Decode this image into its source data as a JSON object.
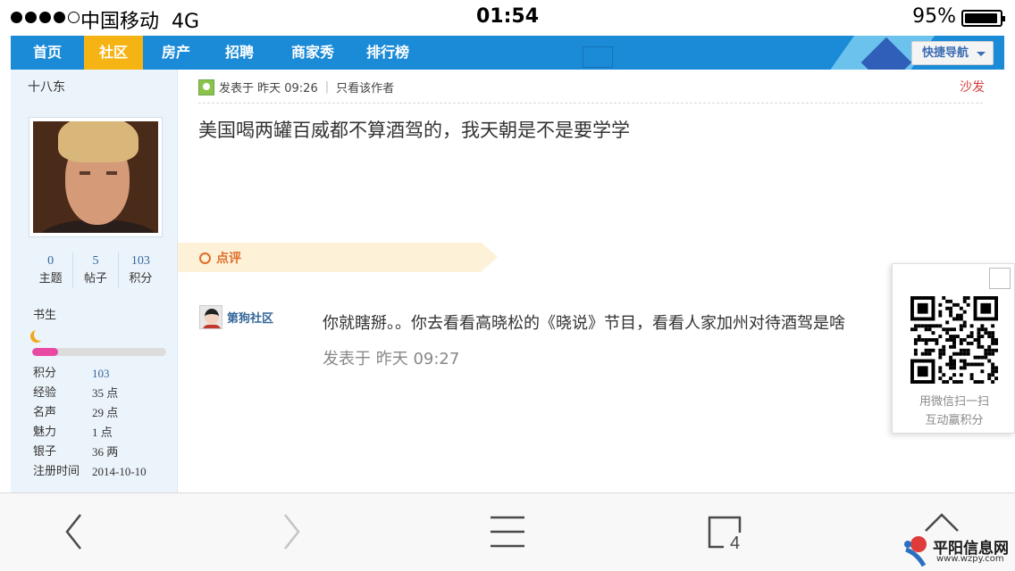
{
  "status_bar": {
    "carrier": "中国移动",
    "network": "4G",
    "time": "01:54",
    "battery_percent": "95%",
    "battery_level": 0.95,
    "signal_bars": 4,
    "signal_max": 5
  },
  "nav": {
    "items": [
      "首页",
      "社区",
      "房产",
      "招聘",
      "商家秀",
      "排行榜"
    ],
    "active_index": 1,
    "quick_nav_label": "快捷导航",
    "bar_color": "#1b8bd8",
    "active_color": "#f6b414"
  },
  "sidebar": {
    "username": "十八东",
    "stats": [
      {
        "value": "0",
        "label": "主题"
      },
      {
        "value": "5",
        "label": "帖子"
      },
      {
        "value": "103",
        "label": "积分"
      }
    ],
    "rank_title": "书生",
    "rank_progress": 0.19,
    "info": [
      {
        "key": "积分",
        "value": "103"
      },
      {
        "key": "经验",
        "value": "35 点"
      },
      {
        "key": "名声",
        "value": "29 点"
      },
      {
        "key": "魅力",
        "value": "1 点"
      },
      {
        "key": "银子",
        "value": "36 两"
      },
      {
        "key": "注册时间",
        "value": "2014-10-10"
      }
    ]
  },
  "post": {
    "meta_posted": "发表于 昨天 09:26",
    "meta_author_only": "只看该作者",
    "floor_label": "沙发",
    "content": "美国喝两罐百威都不算酒驾的，我天朝是不是要学学"
  },
  "comments": {
    "section_label": "点评",
    "items": [
      {
        "author": "第狗社区",
        "text": "你就瞎掰。。你去看看高晓松的《晓说》节目，看看人家加州对待酒驾是啥",
        "time": "发表于 昨天 09:27"
      }
    ]
  },
  "qr_popup": {
    "caption_line1": "用微信扫一扫",
    "caption_line2": "互动赢积分"
  },
  "toolbar": {
    "tabs_count": "4"
  },
  "watermark": {
    "name": "平阳信息网",
    "url": "www.wzpy.com"
  }
}
